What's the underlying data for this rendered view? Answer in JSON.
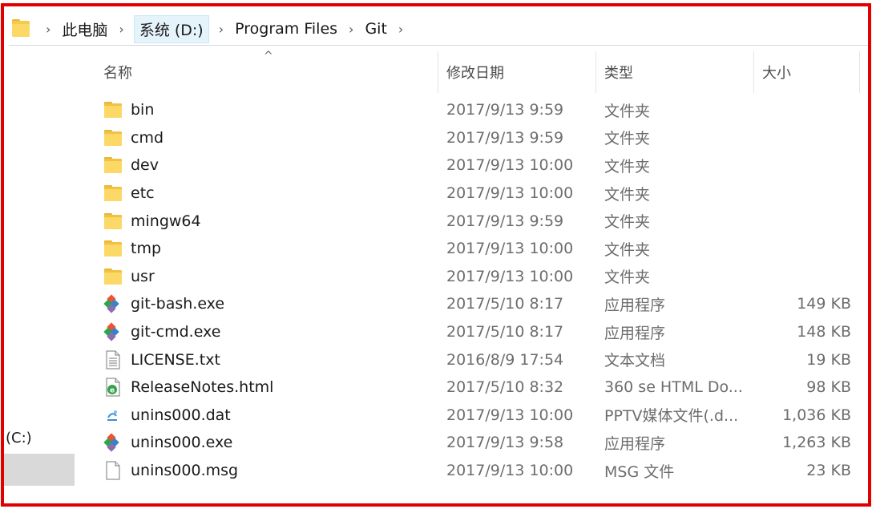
{
  "breadcrumb": {
    "items": [
      "此电脑",
      "系统 (D:)",
      "Program Files",
      "Git"
    ]
  },
  "nav": {
    "drive_label": "(C:)"
  },
  "columns": {
    "name": "名称",
    "date": "修改日期",
    "type": "类型",
    "size": "大小"
  },
  "files": [
    {
      "name": "bin",
      "date": "2017/9/13 9:59",
      "type": "文件夹",
      "size": "",
      "icon": "folder-icon"
    },
    {
      "name": "cmd",
      "date": "2017/9/13 9:59",
      "type": "文件夹",
      "size": "",
      "icon": "folder-icon"
    },
    {
      "name": "dev",
      "date": "2017/9/13 10:00",
      "type": "文件夹",
      "size": "",
      "icon": "folder-icon"
    },
    {
      "name": "etc",
      "date": "2017/9/13 10:00",
      "type": "文件夹",
      "size": "",
      "icon": "folder-icon"
    },
    {
      "name": "mingw64",
      "date": "2017/9/13 9:59",
      "type": "文件夹",
      "size": "",
      "icon": "folder-icon"
    },
    {
      "name": "tmp",
      "date": "2017/9/13 10:00",
      "type": "文件夹",
      "size": "",
      "icon": "folder-icon"
    },
    {
      "name": "usr",
      "date": "2017/9/13 10:00",
      "type": "文件夹",
      "size": "",
      "icon": "folder-icon"
    },
    {
      "name": "git-bash.exe",
      "date": "2017/5/10 8:17",
      "type": "应用程序",
      "size": "149 KB",
      "icon": "git-icon"
    },
    {
      "name": "git-cmd.exe",
      "date": "2017/5/10 8:17",
      "type": "应用程序",
      "size": "148 KB",
      "icon": "git-icon"
    },
    {
      "name": "LICENSE.txt",
      "date": "2016/8/9 17:54",
      "type": "文本文档",
      "size": "19 KB",
      "icon": "text-file-icon"
    },
    {
      "name": "ReleaseNotes.html",
      "date": "2017/5/10 8:32",
      "type": "360 se HTML Do...",
      "size": "98 KB",
      "icon": "html-file-icon"
    },
    {
      "name": "unins000.dat",
      "date": "2017/9/13 10:00",
      "type": "PPTV媒体文件(.d...",
      "size": "1,036 KB",
      "icon": "dat-file-icon"
    },
    {
      "name": "unins000.exe",
      "date": "2017/9/13 9:58",
      "type": "应用程序",
      "size": "1,263 KB",
      "icon": "git-icon"
    },
    {
      "name": "unins000.msg",
      "date": "2017/9/13 10:00",
      "type": "MSG 文件",
      "size": "23 KB",
      "icon": "blank-file-icon"
    }
  ],
  "colors": {
    "frame_border": "#e00000",
    "folder": "#fcd966",
    "git": "#f05133"
  }
}
